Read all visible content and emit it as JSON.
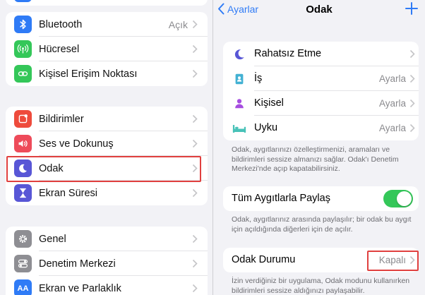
{
  "left": {
    "group1": [
      {
        "icon": "bluetooth-icon",
        "color": "#2f7bf6",
        "label": "Bluetooth",
        "value": "Açık"
      },
      {
        "icon": "cellular-icon",
        "color": "#34c759",
        "label": "Hücresel",
        "value": ""
      },
      {
        "icon": "hotspot-icon",
        "color": "#34c759",
        "label": "Kişisel Erişim Noktası",
        "value": ""
      }
    ],
    "group2": [
      {
        "icon": "notifications-icon",
        "color": "#ee4b3c",
        "label": "Bildirimler"
      },
      {
        "icon": "sound-icon",
        "color": "#ee4b5a",
        "label": "Ses ve Dokunuş"
      },
      {
        "icon": "moon-icon",
        "color": "#5856d6",
        "label": "Odak"
      },
      {
        "icon": "hourglass-icon",
        "color": "#5856d6",
        "label": "Ekran Süresi"
      }
    ],
    "group3": [
      {
        "icon": "gear-icon",
        "color": "#8e8e93",
        "label": "Genel"
      },
      {
        "icon": "switches-icon",
        "color": "#8e8e93",
        "label": "Denetim Merkezi"
      },
      {
        "icon": "text-size-icon",
        "color": "#2f7bf6",
        "label": "Ekran ve Parlaklık",
        "icon_text": "AA"
      }
    ]
  },
  "right": {
    "nav": {
      "back_label": "Ayarlar",
      "title": "Odak"
    },
    "focus_modes": [
      {
        "icon": "moon-icon",
        "label": "Rahatsız Etme",
        "value": ""
      },
      {
        "icon": "work-badge-icon",
        "label": "İş",
        "value": "Ayarla"
      },
      {
        "icon": "person-icon",
        "label": "Kişisel",
        "value": "Ayarla"
      },
      {
        "icon": "bed-icon",
        "label": "Uyku",
        "value": "Ayarla"
      }
    ],
    "focus_note": "Odak, aygıtlarınızı özelleştirmenizi, aramaları ve bildirimleri sessize almanızı sağlar. Odak'ı Denetim Merkezi'nde açıp kapatabilirsiniz.",
    "share": {
      "label": "Tüm Aygıtlarla Paylaş",
      "on": true
    },
    "share_note": "Odak, aygıtlarınız arasında paylaşılır; bir odak bu aygıt için açıldığında diğerleri için de açılır.",
    "status": {
      "label": "Odak Durumu",
      "value": "Kapalı"
    },
    "status_note": "İzin verdiğiniz bir uygulama, Odak modunu kullanırken bildirimleri sessize aldığınızı paylaşabilir."
  }
}
